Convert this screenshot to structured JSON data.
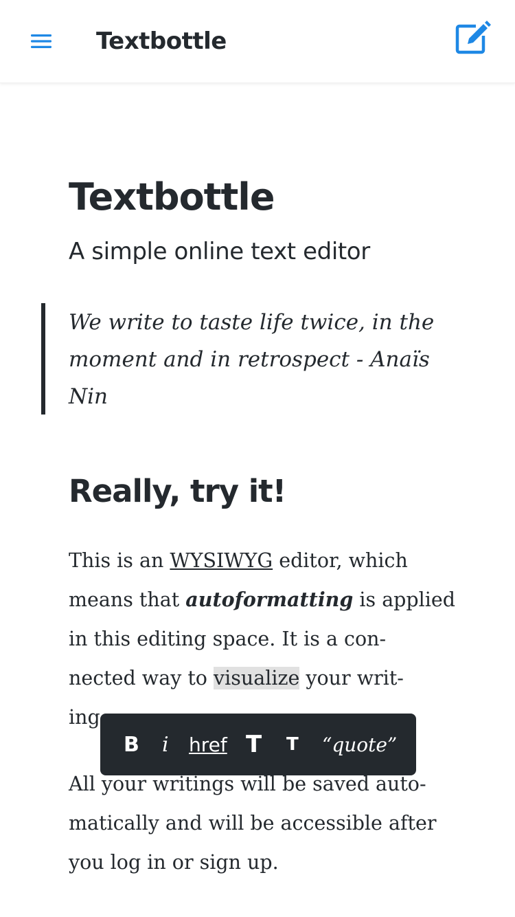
{
  "app": {
    "title": "Textbottle",
    "accent_color": "#1e88e5",
    "menu_icon": "hamburger-menu-icon",
    "compose_icon": "edit-note-icon"
  },
  "document": {
    "title": "Textbottle",
    "subtitle": "A simple online text editor",
    "quote": {
      "lines": [
        "We write to taste life twice, in the",
        "moment and in retrospect - Anaïs",
        "Nin"
      ]
    },
    "section_heading": "Really, try it!",
    "paragraph1": {
      "l1_a": "This is an ",
      "l1_link": "WYSIWYG",
      "l1_b": " editor, which",
      "l2_a": "means that ",
      "l2_em": "autoformatting",
      "l2_b": " is applied",
      "l3": "in this editing space.  It is a con-",
      "l4_a": "nected way to ",
      "l4_highlight": "visualize",
      "l4_b": " your writ-",
      "l5": "ing"
    },
    "paragraph2": {
      "lines": [
        "All your writings will be saved auto-",
        "matically and will be accessible after",
        "you log in or sign up."
      ]
    }
  },
  "toolbar": {
    "bold": "B",
    "italic": "i",
    "link": "href",
    "heading_large": "T",
    "heading_small": "T",
    "quote": "“quote”"
  }
}
